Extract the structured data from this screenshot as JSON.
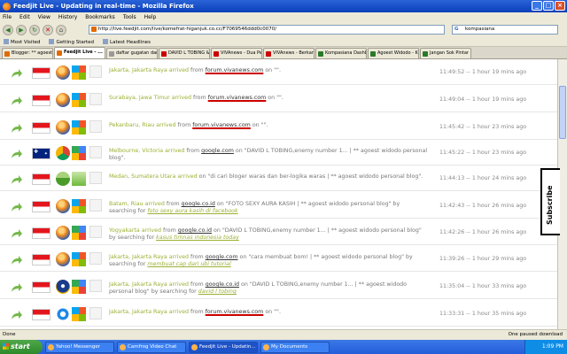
{
  "window": {
    "title": "Feedjit Live - Updating in real-time - Mozilla Firefox"
  },
  "menu": [
    "File",
    "Edit",
    "View",
    "History",
    "Bookmarks",
    "Tools",
    "Help"
  ],
  "url": "http://live.feedjit.com/live/komefrat-higanjuk.co.cc/F7069546ddd0c0070/",
  "search": {
    "engine": "G",
    "value": "kompasiana"
  },
  "bookmarks": [
    "Most Visited",
    "Getting Started",
    "Latest Headlines"
  ],
  "tabs": [
    {
      "label": "Blogger: ** agoest ...",
      "active": false,
      "color": "#e06a00"
    },
    {
      "label": "Feedjit Live - ...",
      "active": true,
      "color": "#e06a00"
    },
    {
      "label": "daftar gugatan dari...",
      "active": false,
      "color": "#999"
    },
    {
      "label": "DAVID L TOBING & ...",
      "active": false,
      "color": "#cc0000"
    },
    {
      "label": "VIVAnews - Dua Pe...",
      "active": false,
      "color": "#cc0000"
    },
    {
      "label": "VIVAnews - Berkan...",
      "active": false,
      "color": "#cc0000"
    },
    {
      "label": "Kompasiana Dashb...",
      "active": false,
      "color": "#2a7a2a"
    },
    {
      "label": "Agoest Widodo - Ko...",
      "active": false,
      "color": "#2a7a2a"
    },
    {
      "label": "Jangan Sok Pintar",
      "active": false,
      "color": "#2a7a2a"
    }
  ],
  "rows": [
    {
      "flag": "id",
      "location": "Jakarta, Jakarta Raya arrived",
      "from": "from",
      "link": "forum.vivanews.com",
      "link_red": true,
      "tail": "on \"\".",
      "search": "",
      "time": "11:49:52 -- 1 hour 19 mins ago",
      "browser": "firefox",
      "os": "windows"
    },
    {
      "flag": "id",
      "location": "Surabaya, Jawa Timur arrived",
      "from": "from",
      "link": "forum.vivanews.com",
      "link_red": true,
      "tail": "on \"\".",
      "search": "",
      "time": "11:49:04 -- 1 hour 19 mins ago",
      "browser": "firefox",
      "os": "windows"
    },
    {
      "flag": "id",
      "location": "Pekanbaru, Riau arrived",
      "from": "from",
      "link": "forum.vivanews.com",
      "link_red": true,
      "tail": "on \"\".",
      "search": "",
      "time": "11:45:42 -- 1 hour 23 mins ago",
      "browser": "firefox",
      "os": "windows"
    },
    {
      "flag": "au",
      "location": "Melbourne, Victoria arrived",
      "from": "from",
      "link": "google.com",
      "link_red": false,
      "tail": "on \"DAVID L TOBING,enemy number 1... | ** agoest widodo personal blog\".",
      "search": "",
      "time": "11:45:22 -- 1 hour 23 mins ago",
      "browser": "chrome",
      "os": "google"
    },
    {
      "flag": "id",
      "location": "Medan, Sumatera Utara arrived",
      "from": "on",
      "link": "",
      "link_red": false,
      "tail": "\"di cari bloger waras dan ber-logika waras | ** agoest widodo personal blog\".",
      "search": "",
      "time": "11:44:13 -- 1 hour 24 mins ago",
      "browser": "reeder",
      "os": "download"
    },
    {
      "flag": "id",
      "location": "Batam, Riau arrived",
      "from": "from",
      "link": "google.co.id",
      "link_red": false,
      "tail": "on \"FOTO SEXY AURA KASIH | ** agoest widodo personal blog\" by searching for",
      "search": "foto sexy aura kasih di facebook",
      "time": "11:42:43 -- 1 hour 26 mins ago",
      "browser": "firefox",
      "os": "windows"
    },
    {
      "flag": "id",
      "location": "Yogyakarta arrived",
      "from": "from",
      "link": "google.co.id",
      "link_red": false,
      "tail": "on \"DAVID L TOBING,enemy number 1... | ** agoest widodo personal blog\" by searching for",
      "search": "kasus timnas indonesia today",
      "time": "11:42:26 -- 1 hour 26 mins ago",
      "browser": "firefox",
      "os": "google"
    },
    {
      "flag": "id",
      "location": "Jakarta, Jakarta Raya arrived",
      "from": "from",
      "link": "google.com",
      "link_red": false,
      "tail": "on \"cara membuat bom! | ** agoest widodo personal blog\" by searching for",
      "search": "membuat cap dari ubi tutorial",
      "time": "11:39:26 -- 1 hour 29 mins ago",
      "browser": "firefox",
      "os": "windows"
    },
    {
      "flag": "id",
      "location": "Jakarta, Jakarta Raya arrived",
      "from": "from",
      "link": "google.co.id",
      "link_red": false,
      "tail": "on \"DAVID L TOBING,enemy number 1... | ** agoest widodo personal blog\" by searching for",
      "search": "david l tobing",
      "time": "11:35:04 -- 1 hour 33 mins ago",
      "browser": "mozilla",
      "os": "google"
    },
    {
      "flag": "id",
      "location": "Jakarta, Jakarta Raya arrived",
      "from": "from",
      "link": "forum.vivanews.com",
      "link_red": true,
      "tail": "on \"\".",
      "search": "",
      "time": "11:33:31 -- 1 hour 35 mins ago",
      "browser": "ie",
      "os": "windows"
    }
  ],
  "subscribe": "Subscribe",
  "status": {
    "left": "Done",
    "right": "One paused download"
  },
  "taskbar": {
    "start": "start",
    "items": [
      {
        "label": "Yahoo! Messenger",
        "active": false
      },
      {
        "label": "Camfrog Video Chat",
        "active": false
      },
      {
        "label": "Feedjit Live - Updatin...",
        "active": true
      },
      {
        "label": "My Documents",
        "active": false
      }
    ],
    "clock": "1:09 PM"
  }
}
